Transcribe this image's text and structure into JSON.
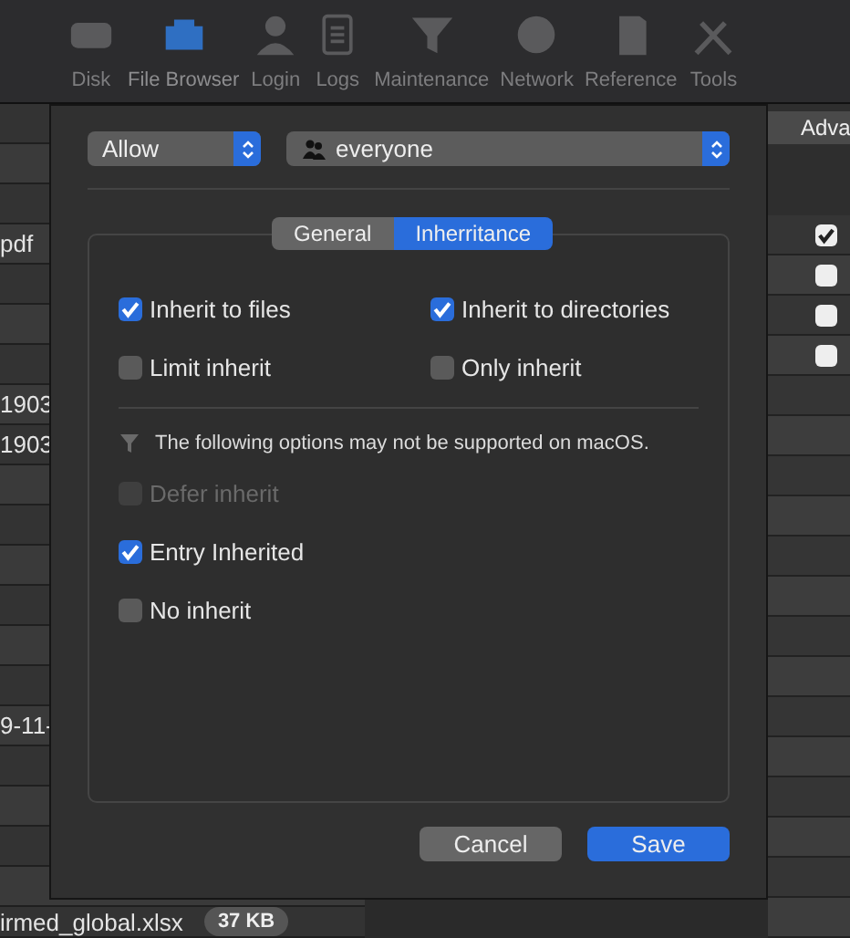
{
  "toolbar": [
    {
      "label": "Disk",
      "selected": false
    },
    {
      "label": "File Browser",
      "selected": true
    },
    {
      "label": "Login",
      "selected": false
    },
    {
      "label": "Logs",
      "selected": false
    },
    {
      "label": "Maintenance",
      "selected": false
    },
    {
      "label": "Network",
      "selected": false
    },
    {
      "label": "Reference",
      "selected": false
    },
    {
      "label": "Tools",
      "selected": false
    }
  ],
  "background_list": {
    "rows": [
      {
        "text": "pdf"
      },
      {
        "text": "1903"
      },
      {
        "text": "1903"
      },
      {
        "text": "9-11-"
      }
    ],
    "last_row": {
      "name": "irmed_global.xlsx",
      "size": "37 KB"
    }
  },
  "background_right": {
    "tab": "Adva",
    "checkboxes": [
      {
        "checked": true
      },
      {
        "checked": false
      },
      {
        "checked": false
      },
      {
        "checked": false
      }
    ]
  },
  "dialog": {
    "access": "Allow",
    "principal": "everyone",
    "tabs": [
      {
        "label": "General",
        "selected": false
      },
      {
        "label": "Inherritance",
        "selected": true
      }
    ],
    "options": [
      {
        "label": "Inherit to files",
        "checked": true,
        "disabled": false
      },
      {
        "label": "Inherit to directories",
        "checked": true,
        "disabled": false
      },
      {
        "label": "Limit inherit",
        "checked": false,
        "disabled": false
      },
      {
        "label": "Only inherit",
        "checked": false,
        "disabled": false
      }
    ],
    "warning": "The following options may not be supported on macOS.",
    "extra_options": [
      {
        "label": "Defer inherit",
        "checked": false,
        "disabled": true
      },
      {
        "label": "Entry Inherited",
        "checked": true,
        "disabled": false
      },
      {
        "label": "No inherit",
        "checked": false,
        "disabled": false
      }
    ],
    "buttons": [
      {
        "label": "Cancel",
        "kind": "secondary"
      },
      {
        "label": "Save",
        "kind": "primary"
      }
    ]
  }
}
